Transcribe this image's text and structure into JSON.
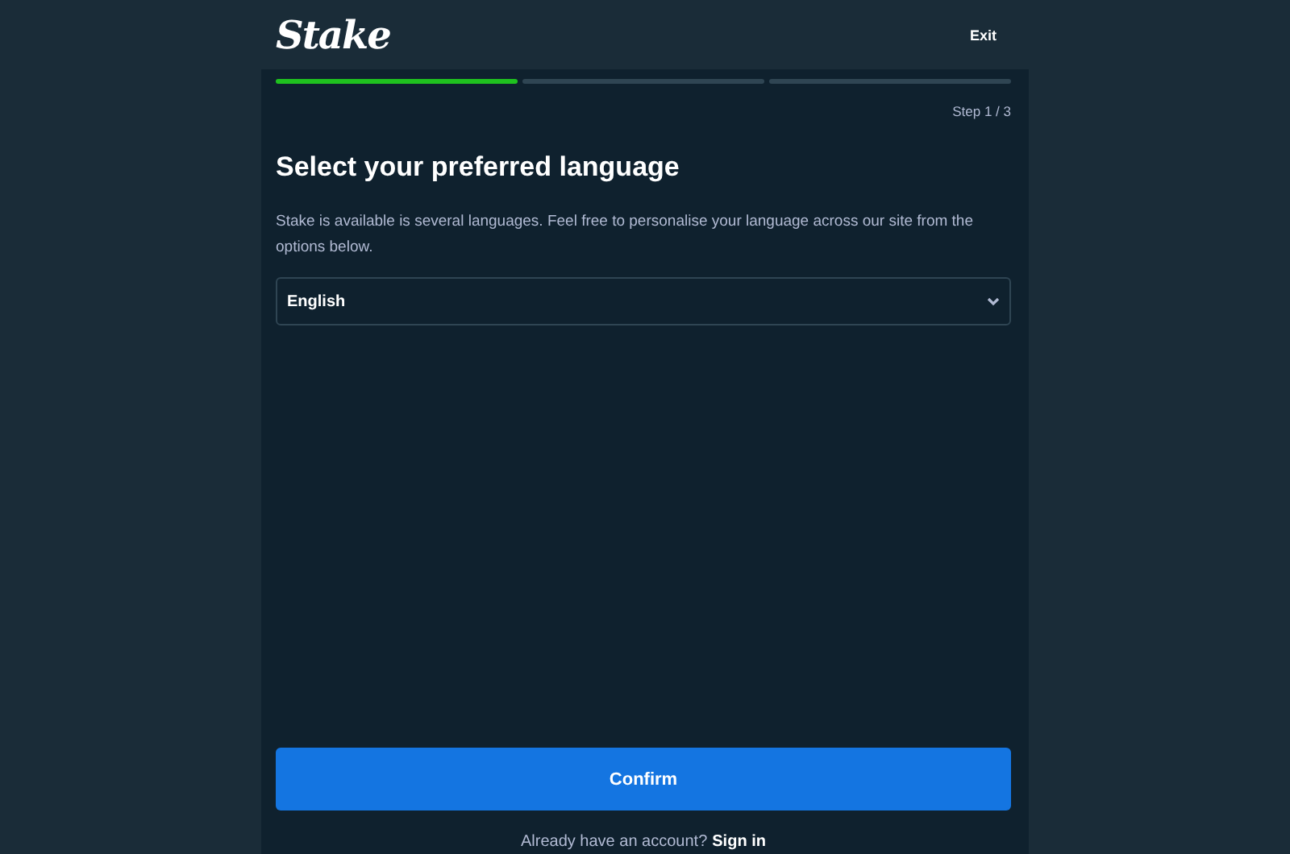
{
  "header": {
    "logo": "Stake",
    "exit": "Exit"
  },
  "progress": [
    {
      "completed": true
    },
    {
      "completed": false
    },
    {
      "completed": false
    }
  ],
  "step": "Step 1 / 3",
  "title": "Select your preferred language",
  "description": "Stake is available is several languages. Feel free to personalise your language across our site from the options below.",
  "language_select": {
    "value": "English"
  },
  "confirm": "Confirm",
  "footer": {
    "text": "Already have an account?",
    "link": "Sign in"
  }
}
